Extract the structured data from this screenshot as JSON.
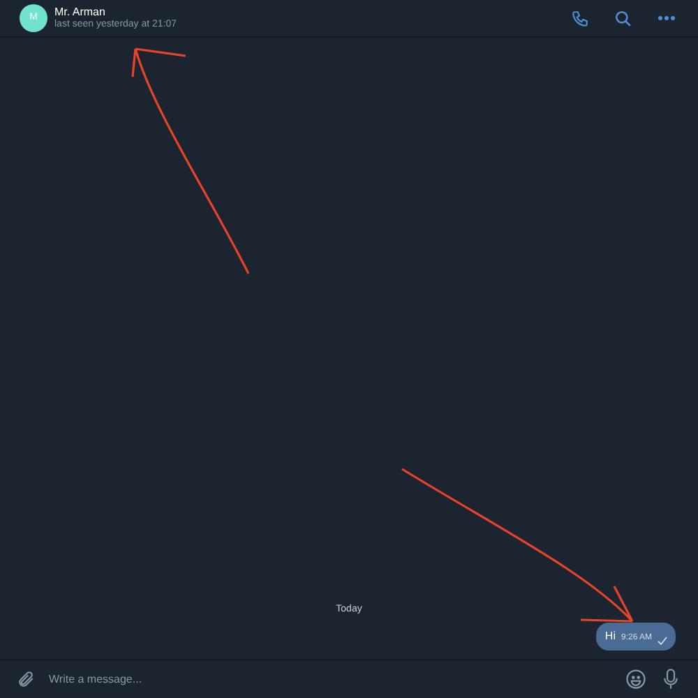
{
  "header": {
    "avatar_initial": "M",
    "name": "Mr. Arman",
    "status": "last seen yesterday at 21:07"
  },
  "date_separator": "Today",
  "messages": [
    {
      "text": "Hi",
      "time": "9:26 AM",
      "outgoing": true,
      "sent": true
    }
  ],
  "composer": {
    "placeholder": "Write a message..."
  }
}
